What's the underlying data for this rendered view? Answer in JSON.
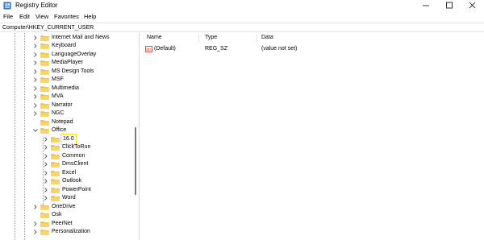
{
  "window": {
    "title": "Registry Editor"
  },
  "menu": {
    "file": "File",
    "edit": "Edit",
    "view": "View",
    "favorites": "Favorites",
    "help": "Help"
  },
  "address": {
    "path": "Computer\\HKEY_CURRENT_USER"
  },
  "tree": {
    "selected": "16.0",
    "items": [
      {
        "label": "Internet Mail and News",
        "expander": "collapsed"
      },
      {
        "label": "Keyboard",
        "expander": "collapsed"
      },
      {
        "label": "LanguageOverlay",
        "expander": "collapsed"
      },
      {
        "label": "MediaPlayer",
        "expander": "collapsed"
      },
      {
        "label": "MS Design Tools",
        "expander": "collapsed"
      },
      {
        "label": "MSF",
        "expander": "collapsed"
      },
      {
        "label": "Multimedia",
        "expander": "collapsed"
      },
      {
        "label": "MVA",
        "expander": "collapsed"
      },
      {
        "label": "Narrator",
        "expander": "collapsed"
      },
      {
        "label": "NGC",
        "expander": "collapsed"
      },
      {
        "label": "Notepad",
        "expander": "none"
      },
      {
        "label": "Office",
        "expander": "expanded"
      },
      {
        "label": "16.0",
        "expander": "collapsed"
      },
      {
        "label": "ClickToRun",
        "expander": "collapsed"
      },
      {
        "label": "Common",
        "expander": "collapsed"
      },
      {
        "label": "DmsClient",
        "expander": "collapsed"
      },
      {
        "label": "Excel",
        "expander": "collapsed"
      },
      {
        "label": "Outlook",
        "expander": "collapsed"
      },
      {
        "label": "PowerPoint",
        "expander": "collapsed"
      },
      {
        "label": "Word",
        "expander": "collapsed"
      },
      {
        "label": "OneDrive",
        "expander": "collapsed"
      },
      {
        "label": "Osk",
        "expander": "none"
      },
      {
        "label": "PeerNet",
        "expander": "collapsed"
      },
      {
        "label": "Personalization",
        "expander": "collapsed"
      }
    ]
  },
  "list": {
    "columns": {
      "name": "Name",
      "type": "Type",
      "data": "Data"
    },
    "rows": [
      {
        "name": "(Default)",
        "type": "REG_SZ",
        "data": "(value not set)",
        "icon": "string-value-icon"
      }
    ]
  },
  "colors": {
    "folder": "#f0c64a",
    "folder_dark": "#d9a82b",
    "selection_outline": "#f3e11b",
    "reg_icon_red": "#c8372d"
  }
}
